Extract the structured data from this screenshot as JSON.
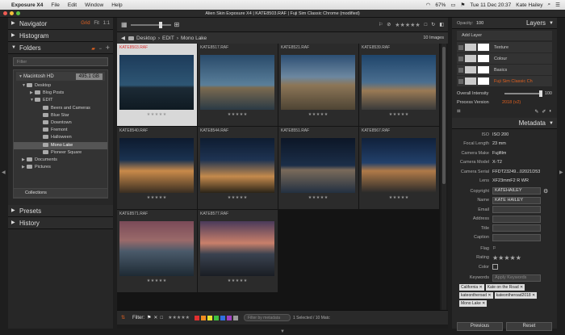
{
  "menubar": {
    "apple": "",
    "app": "Exposure X4",
    "items": [
      "File",
      "Edit",
      "Window",
      "Help"
    ],
    "battery": "67%",
    "clock": "Tue 11 Dec  20:37",
    "user": "Kate Hailey"
  },
  "window": {
    "title": "Alien Skin Exposure X4 | KATE8503.RAF | Fuji Sim Classic Chrome (modified)"
  },
  "left": {
    "navigator": "Navigator",
    "nav_modes": [
      "Grid",
      "Fit",
      "1:1"
    ],
    "histogram": "Histogram",
    "folders": "Folders",
    "filter_placeholder": "Filter",
    "drive": "Macintosh HD",
    "drive_size": "495.1 GB",
    "tree": [
      {
        "label": "Desktop",
        "indent": 1,
        "twisty": "▼"
      },
      {
        "label": "Blog Posts",
        "indent": 2,
        "twisty": "▶"
      },
      {
        "label": "EDIT",
        "indent": 2,
        "twisty": "▼"
      },
      {
        "label": "Beers and Cameras",
        "indent": 3,
        "twisty": ""
      },
      {
        "label": "Blue Star",
        "indent": 3,
        "twisty": ""
      },
      {
        "label": "Downtown",
        "indent": 3,
        "twisty": ""
      },
      {
        "label": "Fremont",
        "indent": 3,
        "twisty": ""
      },
      {
        "label": "Halloween",
        "indent": 3,
        "twisty": ""
      },
      {
        "label": "Mono Lake",
        "indent": 3,
        "twisty": "",
        "selected": true
      },
      {
        "label": "Pioneer Square",
        "indent": 3,
        "twisty": ""
      },
      {
        "label": "Documents",
        "indent": 1,
        "twisty": "▶"
      },
      {
        "label": "Pictures",
        "indent": 1,
        "twisty": "▶"
      }
    ],
    "collections": "Collections",
    "presets": "Presets",
    "history": "History"
  },
  "center": {
    "path": [
      "Desktop",
      "EDIT",
      "Mono Lake"
    ],
    "count": "10 Images",
    "stars": "★★★★★",
    "thumbs": [
      {
        "name": "KATE8503.RAF",
        "selected": true,
        "bg": "linear-gradient(#1d3b5a 0%,#2e5674 55%,#1c2a35 60%,#0f1a22 100%)"
      },
      {
        "name": "KATE8517.RAF",
        "bg": "linear-gradient(#294a6a 0%,#5a7f9a 55%,#7b6a50 60%,#2a3a45 100%)"
      },
      {
        "name": "KATE8521.RAF",
        "bg": "linear-gradient(#2d4f73 0%,#6c87a0 40%,#8c7657 55%,#4e4434 100%)"
      },
      {
        "name": "KATE8539.RAF",
        "bg": "linear-gradient(#1f456b 0%,#4a6e8f 50%,#9a7a55 65%,#3a3a3a 100%)"
      },
      {
        "name": "KATE8540.RAF",
        "bg": "linear-gradient(#0d1a2e 0%,#1a3250 40%,#c98a4a 60%,#3a2e22 100%)"
      },
      {
        "name": "KATE8544.RAF",
        "bg": "linear-gradient(#0e1c30 0%,#1e3352 40%,#c48a4c 70%,#2a2418 100%)"
      },
      {
        "name": "KATE8551.RAF",
        "bg": "linear-gradient(#0c1626 0%,#1b2e48 50%,#7a6a5a 58%,#223041 100%)"
      },
      {
        "name": "KATE8567.RAF",
        "bg": "linear-gradient(#10203a 0%,#22406a 45%,#b07a48 60%,#2a2a2a 100%)"
      },
      {
        "name": "KATE8571.RAF",
        "bg": "linear-gradient(#7a4a58 0%,#9a6a6a 35%,#4a5a6a 55%,#1e2a34 100%)"
      },
      {
        "name": "KATE8577.RAF",
        "bg": "linear-gradient(#4a3a5a 0%,#c9806a 40%,#3a4250 60%,#1a1e24 100%)"
      }
    ],
    "filter_label": "Filter:",
    "filter_colors": [
      "#e03030",
      "#f08c20",
      "#e8e030",
      "#40c040",
      "#3070e0",
      "#a040c0",
      "#999999"
    ],
    "filter_search_placeholder": "Filter by metadata",
    "selection": "1 Selected / 10 Matc"
  },
  "right": {
    "opacity_label": "Opacity:",
    "opacity": "100",
    "layers": "Layers",
    "add_layer": "Add Layer",
    "layer_list": [
      {
        "name": "Texture",
        "active": false
      },
      {
        "name": "Colour",
        "active": false
      },
      {
        "name": "Basics",
        "active": false
      },
      {
        "name": "Fuji Sim Classic Ch",
        "active": true
      }
    ],
    "overall_intensity_label": "Overall Intensity",
    "overall_intensity": "100",
    "process_version_label": "Process Version",
    "process_version": "2018 (v2)",
    "metadata": "Metadata",
    "meta": [
      {
        "k": "ISO",
        "v": "ISO 200"
      },
      {
        "k": "Focal Length",
        "v": "23 mm"
      },
      {
        "k": "Camera Make",
        "v": "Fujifilm"
      },
      {
        "k": "Camera Model",
        "v": "X-T2"
      },
      {
        "k": "Camera Serial",
        "v": "FFDT23249...02021D53"
      },
      {
        "k": "Lens",
        "v": "XF23mmF2 R WR"
      }
    ],
    "copyright_label": "Copyright",
    "copyright": "KATEHAILEY",
    "name_label": "Name",
    "name": "KATE HAILEY",
    "email_label": "Email",
    "address_label": "Address",
    "title_label": "Title",
    "caption_label": "Caption",
    "flag_label": "Flag",
    "rating_label": "Rating",
    "color_label": "Color",
    "keywords_label": "Keywords",
    "keywords_placeholder": "Apply Keywords",
    "keywords": [
      "California",
      "Kate on the Road",
      "kateontheroad",
      "kateontheroad2018",
      "Mono Lake"
    ],
    "previous": "Previous",
    "reset": "Reset"
  }
}
